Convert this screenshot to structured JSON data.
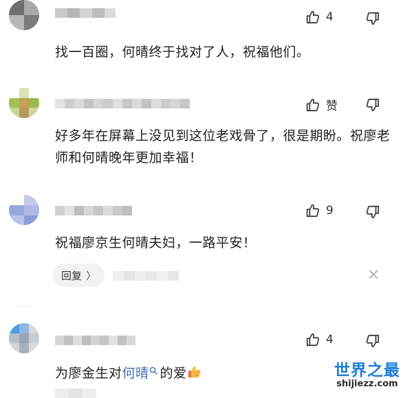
{
  "comments": [
    {
      "likes": "4",
      "text": "找一百圈，何晴终于找对了人，祝福他们。"
    },
    {
      "likes": "赞",
      "text": "好多年在屏幕上没见到这位老戏骨了，很是期盼。祝廖老师和何晴晚年更加幸福！"
    },
    {
      "likes": "9",
      "text": "祝福廖京生何晴夫妇，一路平安！",
      "reply_label": "回复",
      "reply_chevron": "〉",
      "close_glyph": "✕"
    },
    {
      "likes": "4",
      "text_pre": "为廖金生对",
      "keyword": "何晴",
      "keyword_search_icon": "search-icon",
      "text_post": "的爱",
      "emoji": "thumbs-up-emoji"
    }
  ],
  "icons": {
    "like": "thumbs-up-icon",
    "dislike": "thumbs-down-icon"
  },
  "watermark": {
    "title": "世界之最",
    "url": "shijiezz.com"
  },
  "colors": {
    "keyword": "#3d6fb4",
    "watermark_title": "#1d7fd8",
    "reply_bg": "#f2f2f2"
  }
}
